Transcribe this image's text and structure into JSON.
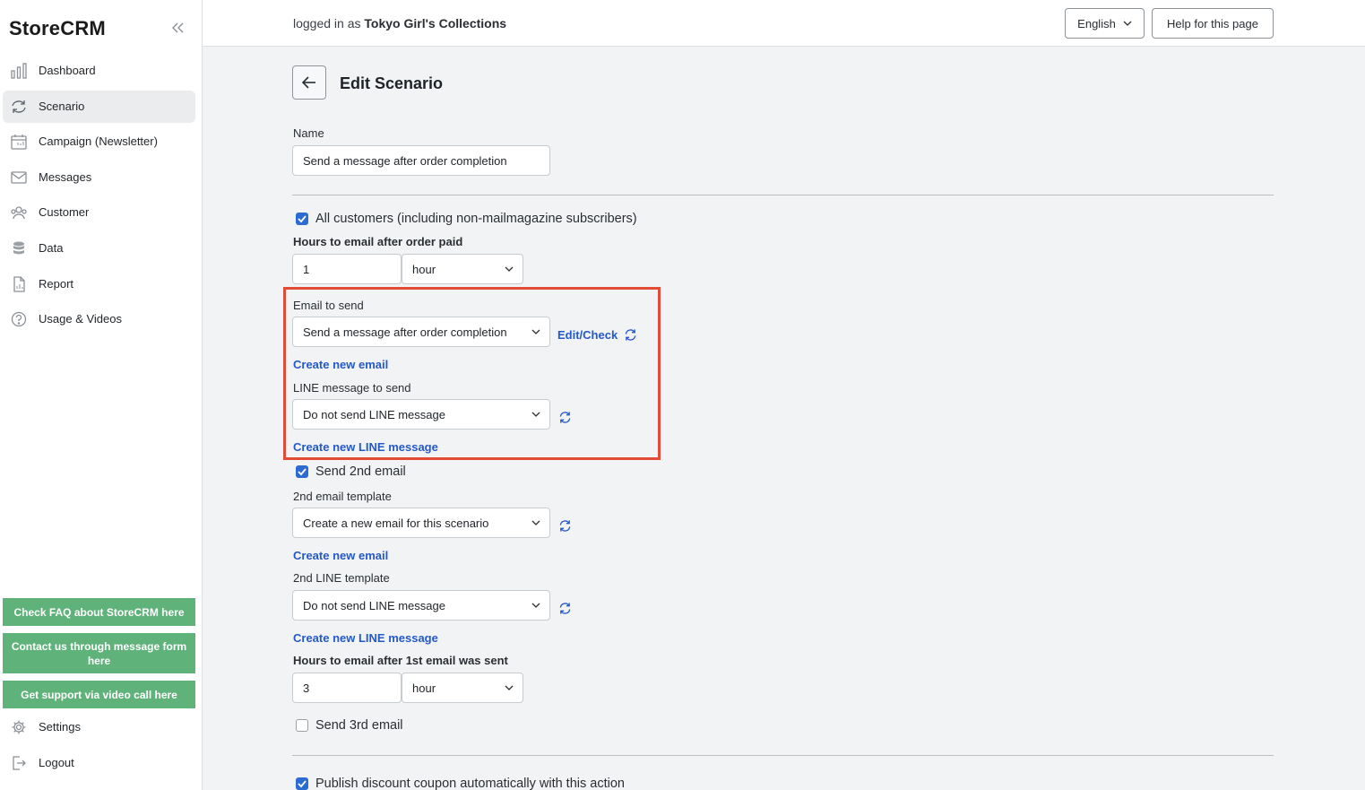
{
  "app": {
    "logo": "StoreCRM"
  },
  "sidebar": {
    "items": [
      {
        "label": "Dashboard",
        "icon": "bar-chart-icon"
      },
      {
        "label": "Scenario",
        "icon": "refresh-icon",
        "active": true
      },
      {
        "label": "Campaign (Newsletter)",
        "icon": "calendar-icon"
      },
      {
        "label": "Messages",
        "icon": "envelope-icon"
      },
      {
        "label": "Customer",
        "icon": "users-icon"
      },
      {
        "label": "Data",
        "icon": "database-icon"
      },
      {
        "label": "Report",
        "icon": "document-icon"
      },
      {
        "label": "Usage & Videos",
        "icon": "help-circle-icon"
      }
    ],
    "support_buttons": [
      "Check FAQ about StoreCRM here",
      "Contact us through message form here",
      "Get support via video call here"
    ],
    "bottom_items": [
      {
        "label": "Settings",
        "icon": "gear-icon"
      },
      {
        "label": "Logout",
        "icon": "logout-icon"
      }
    ]
  },
  "header": {
    "logged_in_prefix": "logged in as",
    "store_name": "Tokyo Girl's Collections",
    "language": "English",
    "help_button": "Help for this page"
  },
  "page": {
    "title": "Edit Scenario",
    "name_label": "Name",
    "name_value": "Send a message after order completion",
    "all_customers_label": "All customers (including non-mailmagazine subscribers)",
    "all_customers_checked": true,
    "hours_label": "Hours to email after order paid",
    "hours_value": "1",
    "hours_unit": "hour",
    "email_to_send_label": "Email to send",
    "email_to_send_value": "Send a message after order completion",
    "edit_check_link": "Edit/Check",
    "create_new_email": "Create new email",
    "line_message_label": "LINE message to send",
    "line_message_value": "Do not send LINE message",
    "create_new_line": "Create new LINE message",
    "send_2nd_label": "Send 2nd email",
    "send_2nd_checked": true,
    "second_template_label": "2nd email template",
    "second_template_value": "Create a new email for this scenario",
    "create_new_email_2": "Create new email",
    "second_line_label": "2nd LINE template",
    "second_line_value": "Do not send LINE message",
    "create_new_line_2": "Create new LINE message",
    "hours_after_first_label": "Hours to email after 1st email was sent",
    "hours_after_first_value": "3",
    "hours_after_first_unit": "hour",
    "send_3rd_label": "Send 3rd email",
    "send_3rd_checked": false,
    "coupon_label": "Publish discount coupon automatically with this action",
    "coupon_checked": true
  },
  "colors": {
    "accent": "#2c6bd1",
    "link": "#2459c8",
    "support_green": "#5fb27a",
    "highlight_red": "#e24b35"
  }
}
